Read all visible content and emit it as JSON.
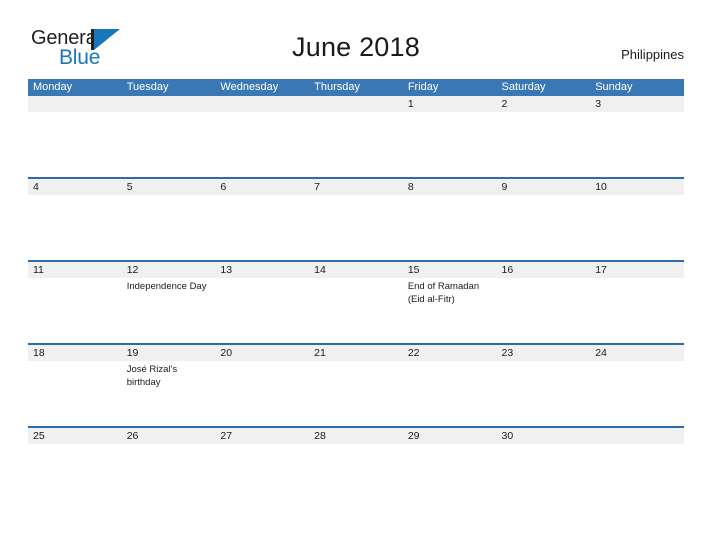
{
  "brand": {
    "name_line1": "General",
    "name_line2": "Blue",
    "mark": "triangle-flag-icon",
    "accent_color": "#1877bc"
  },
  "header": {
    "title": "June 2018",
    "region": "Philippines",
    "header_bar_color": "#3a78b5",
    "date_band_color": "#f0f0f0",
    "week_rule_color": "#2c6ca8"
  },
  "calendar": {
    "weekdays": [
      "Monday",
      "Tuesday",
      "Wednesday",
      "Thursday",
      "Friday",
      "Saturday",
      "Sunday"
    ],
    "weeks": [
      {
        "dates": [
          "",
          "",
          "",
          "",
          "1",
          "2",
          "3"
        ],
        "events": [
          "",
          "",
          "",
          "",
          "",
          "",
          ""
        ]
      },
      {
        "dates": [
          "4",
          "5",
          "6",
          "7",
          "8",
          "9",
          "10"
        ],
        "events": [
          "",
          "",
          "",
          "",
          "",
          "",
          ""
        ]
      },
      {
        "dates": [
          "11",
          "12",
          "13",
          "14",
          "15",
          "16",
          "17"
        ],
        "events": [
          "",
          "Independence Day",
          "",
          "",
          "End of Ramadan (Eid al-Fitr)",
          "",
          ""
        ]
      },
      {
        "dates": [
          "18",
          "19",
          "20",
          "21",
          "22",
          "23",
          "24"
        ],
        "events": [
          "",
          "José Rizal's birthday",
          "",
          "",
          "",
          "",
          ""
        ]
      },
      {
        "dates": [
          "25",
          "26",
          "27",
          "28",
          "29",
          "30",
          ""
        ],
        "events": [
          "",
          "",
          "",
          "",
          "",
          "",
          ""
        ]
      }
    ]
  }
}
